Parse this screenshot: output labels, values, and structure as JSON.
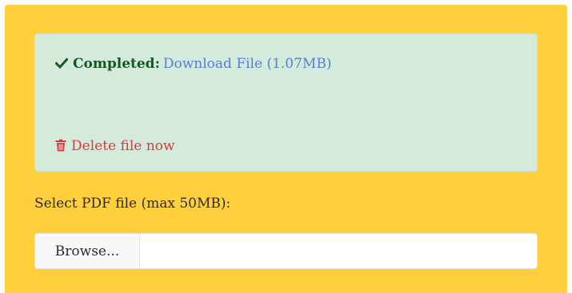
{
  "result": {
    "status_label": "Completed:",
    "download_link": "Download File (1.07MB)",
    "delete_link": "Delete file now"
  },
  "upload": {
    "label": "Select PDF file (max 50MB):",
    "browse_label": "Browse...",
    "file_name": ""
  },
  "colors": {
    "panel_background": "#ffcf3d",
    "alert_background": "#d4ebdb",
    "success_text": "#155724",
    "link": "#5b7bd5",
    "danger": "#dc3545"
  },
  "icons": {
    "status": "check-icon",
    "delete": "trash-icon"
  }
}
